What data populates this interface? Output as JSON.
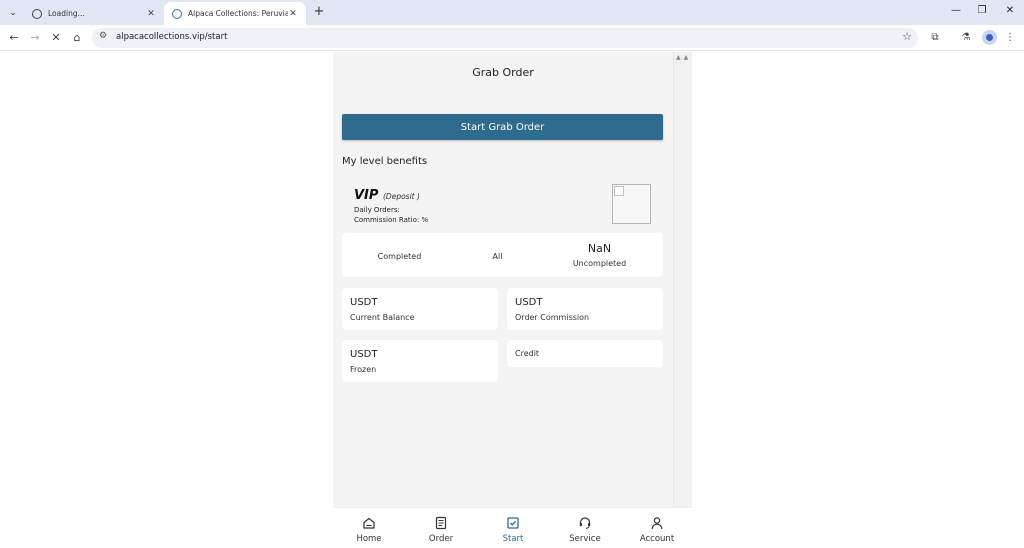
{
  "browser": {
    "tabs": [
      {
        "title": "Loading...",
        "active": false
      },
      {
        "title": "Alpaca Collections: Peruvian Al",
        "active": true
      }
    ],
    "url": "alpacacollections.vip/start"
  },
  "page": {
    "title": "Grab Order",
    "start_button": "Start Grab Order",
    "level_section_title": "My level benefits",
    "vip": {
      "name": "VIP",
      "deposit": "(Deposit  )",
      "daily_orders": "Daily Orders:",
      "commission_ratio": "Commission Ratio: %"
    },
    "stats": [
      {
        "value": "",
        "label": "Completed"
      },
      {
        "value": "",
        "label": "All"
      },
      {
        "value": "NaN",
        "label": "Uncompleted"
      }
    ],
    "cards": [
      {
        "currency": "USDT",
        "label": "Current Balance"
      },
      {
        "currency": "USDT",
        "label": "Order Commission"
      },
      {
        "currency": "USDT",
        "label": "Frozen"
      },
      {
        "currency": "",
        "label": "Credit"
      }
    ]
  },
  "bottom_nav": [
    {
      "label": "Home",
      "icon": "home-icon",
      "active": false
    },
    {
      "label": "Order",
      "icon": "order-icon",
      "active": false
    },
    {
      "label": "Start",
      "icon": "start-icon",
      "active": true
    },
    {
      "label": "Service",
      "icon": "headset-icon",
      "active": false
    },
    {
      "label": "Account",
      "icon": "user-icon",
      "active": false
    }
  ],
  "colors": {
    "accent": "#2e6b8e",
    "background": "#f4f4f4",
    "card": "#ffffff"
  }
}
